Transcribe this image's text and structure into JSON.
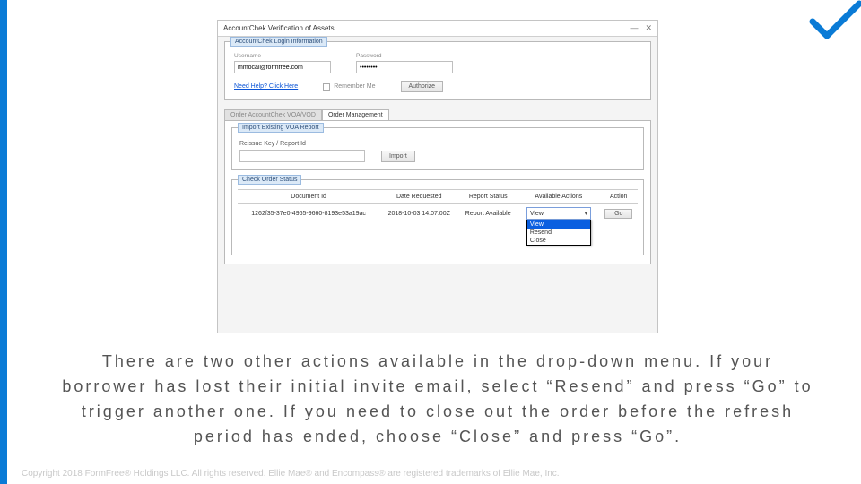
{
  "logo": {
    "color": "#0a7bd6"
  },
  "window": {
    "title": "AccountChek Verification of Assets",
    "controls": {
      "minimize": "—",
      "close": "✕"
    }
  },
  "login": {
    "group_title": "AccountChek Login Information",
    "username_label": "Username",
    "username_value": "mmocal@formfree.com",
    "password_label": "Password",
    "password_value": "••••••••",
    "help_link": "Need Help? Click Here",
    "remember_label": "Remember Me",
    "authorize_btn": "Authorize"
  },
  "tabs": {
    "tab1": "Order AccountChek VOA/VOD",
    "tab2": "Order Management"
  },
  "import": {
    "title": "Import Existing VOA Report",
    "label": "Reissue Key / Report Id",
    "btn": "Import"
  },
  "order_status": {
    "title": "Check Order Status",
    "headers": {
      "doc_id": "Document Id",
      "date": "Date Requested",
      "report_status": "Report Status",
      "actions": "Available Actions",
      "action": "Action"
    },
    "row": {
      "doc_id": "1262f35-37e0-4965-9660-8193e53a19ac",
      "date": "2018-10-03 14:07:00Z",
      "status": "Report Available",
      "go_btn": "Go"
    },
    "dropdown": {
      "selected": "View",
      "options": [
        "View",
        "Resend",
        "Close"
      ]
    }
  },
  "caption": "There are two other actions available in the drop-down menu. If your borrower has lost their initial invite email, select “Resend” and press “Go” to trigger another one. If you need to close out the order before the refresh period has ended, choose “Close” and press “Go”.",
  "footer": "Copyright 2018 FormFree® Holdings LLC. All rights reserved. Ellie Mae® and Encompass® are registered trademarks of Ellie Mae, Inc."
}
